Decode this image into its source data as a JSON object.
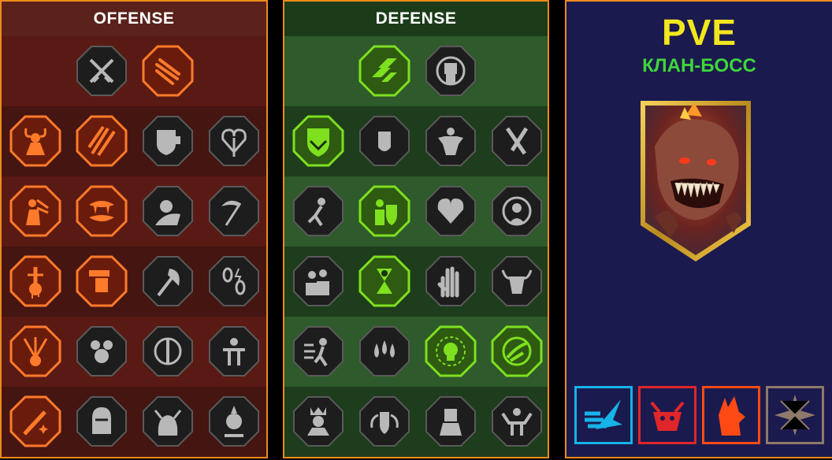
{
  "offense": {
    "title": "OFFENSE",
    "rows": [
      [
        {
          "icon": "crossed-swords-icon",
          "active": false
        },
        {
          "icon": "slashing-claws-icon",
          "active": true
        }
      ],
      [
        {
          "icon": "horned-demon-icon",
          "active": true
        },
        {
          "icon": "triple-blade-icon",
          "active": true
        },
        {
          "icon": "fist-shield-icon",
          "active": false
        },
        {
          "icon": "pierced-heart-icon",
          "active": false
        }
      ],
      [
        {
          "icon": "warrior-arrows-icon",
          "active": true
        },
        {
          "icon": "fanged-maw-icon",
          "active": true
        },
        {
          "icon": "skull-cloak-icon",
          "active": false
        },
        {
          "icon": "scythe-icon",
          "active": false
        }
      ],
      [
        {
          "icon": "bleeding-sword-icon",
          "active": true
        },
        {
          "icon": "fist-hammer-icon",
          "active": true
        },
        {
          "icon": "axe-icon",
          "active": false
        },
        {
          "icon": "broken-chains-icon",
          "active": false
        }
      ],
      [
        {
          "icon": "arrows-impact-icon",
          "active": true
        },
        {
          "icon": "triple-skull-icon",
          "active": false
        },
        {
          "icon": "sword-aura-icon",
          "active": false
        },
        {
          "icon": "bound-warrior-icon",
          "active": false
        }
      ],
      [
        {
          "icon": "sparkle-sword-icon",
          "active": true
        },
        {
          "icon": "knight-helm-icon",
          "active": false
        },
        {
          "icon": "beast-rage-icon",
          "active": false
        },
        {
          "icon": "skull-spikes-icon",
          "active": false
        }
      ]
    ]
  },
  "defense": {
    "title": "DEFENSE",
    "rows": [
      [
        {
          "icon": "armor-plates-icon",
          "active": true
        },
        {
          "icon": "raised-fist-icon",
          "active": false
        }
      ],
      [
        {
          "icon": "shield-chevron-icon",
          "active": true
        },
        {
          "icon": "fist-guard-icon",
          "active": false
        },
        {
          "icon": "muscle-body-icon",
          "active": false
        },
        {
          "icon": "crossed-blades-icon",
          "active": false
        }
      ],
      [
        {
          "icon": "dodging-figure-icon",
          "active": false
        },
        {
          "icon": "knight-shield-icon",
          "active": true
        },
        {
          "icon": "dark-heart-icon",
          "active": false
        },
        {
          "icon": "hooded-figure-icon",
          "active": false
        }
      ],
      [
        {
          "icon": "crowd-icon",
          "active": false
        },
        {
          "icon": "hourglass-skull-icon",
          "active": true
        },
        {
          "icon": "open-hand-icon",
          "active": false
        },
        {
          "icon": "bull-skull-icon",
          "active": false
        }
      ],
      [
        {
          "icon": "speeding-figure-icon",
          "active": false
        },
        {
          "icon": "triple-drops-icon",
          "active": false
        },
        {
          "icon": "radiant-skull-icon",
          "active": true
        },
        {
          "icon": "grasping-hand-icon",
          "active": true
        }
      ],
      [
        {
          "icon": "crowned-head-icon",
          "active": false
        },
        {
          "icon": "winged-shield-icon",
          "active": false
        },
        {
          "icon": "dark-lord-icon",
          "active": false
        },
        {
          "icon": "strongman-icon",
          "active": false
        }
      ]
    ]
  },
  "info": {
    "title": "PVE",
    "subtitle": "КЛАН-БОСС",
    "portrait_icon": "demon-boss-portrait-icon",
    "affinities": [
      {
        "icon": "magic-wing-icon",
        "color": "#16b3e8"
      },
      {
        "icon": "force-demon-icon",
        "color": "#e0262a"
      },
      {
        "icon": "spirit-wolf-icon",
        "color": "#ff4a14"
      },
      {
        "icon": "void-star-icon",
        "color": "#8e7a6a"
      }
    ]
  },
  "colors": {
    "panel_border": "#f08a1c",
    "offense_active": "#ff7a2a",
    "defense_active": "#7ee01f",
    "inactive": "#b8b8b8"
  }
}
